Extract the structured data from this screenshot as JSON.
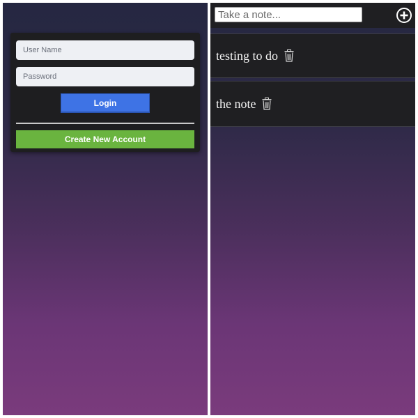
{
  "login": {
    "username_placeholder": "User Name",
    "password_placeholder": "Password",
    "login_label": "Login",
    "create_account_label": "Create New Account"
  },
  "notes": {
    "input_placeholder": "Take a note...",
    "add_icon": "plus-circle-icon",
    "items": [
      {
        "text": "testing to do",
        "delete_icon": "trash-icon"
      },
      {
        "text": "the note",
        "delete_icon": "trash-icon"
      }
    ]
  },
  "colors": {
    "login_button": "#3e73e5",
    "create_button": "#6ab43f",
    "card_background": "#1e1e20",
    "gradient_top": "#252741",
    "gradient_bottom": "#7a3b7c"
  }
}
